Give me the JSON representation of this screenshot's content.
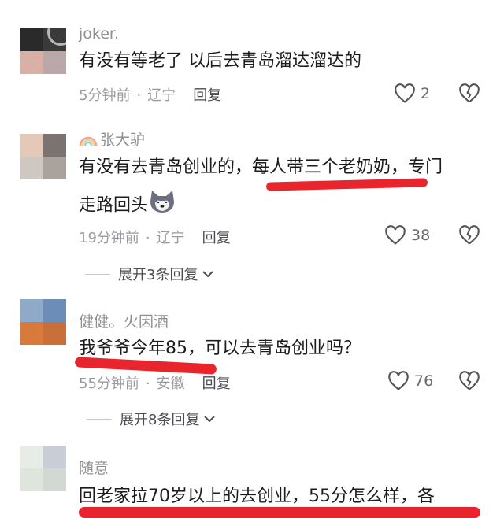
{
  "comments": [
    {
      "username": "joker.",
      "text": "有没有等老了 以后去青岛溜达溜达的",
      "time": "5分钟前",
      "location": "辽宁",
      "reply_label": "回复",
      "likes": "2"
    },
    {
      "username": "张大驴",
      "text_line1": "有没有去青岛创业的，每人带三个老奶奶，专门",
      "text_line2": "走路回头",
      "time": "19分钟前",
      "location": "辽宁",
      "reply_label": "回复",
      "likes": "38",
      "expand_label": "展开3条回复"
    },
    {
      "username": "健健。火因酒",
      "text": "我爷爷今年85，可以去青岛创业吗？",
      "time": "55分钟前",
      "location": "安徽",
      "reply_label": "回复",
      "likes": "76",
      "expand_label": "展开8条回复"
    },
    {
      "username": "随意",
      "text": "回老家拉70岁以上的去创业，55分怎么样，各"
    }
  ],
  "colors": {
    "highlight": "#e8252c",
    "text": "#1c1c1e",
    "meta": "#9a9aa0"
  },
  "icons": [
    "heart-icon",
    "broken-heart-icon",
    "chevron-down-icon",
    "rainbow-icon",
    "wolf-emoji-icon"
  ]
}
